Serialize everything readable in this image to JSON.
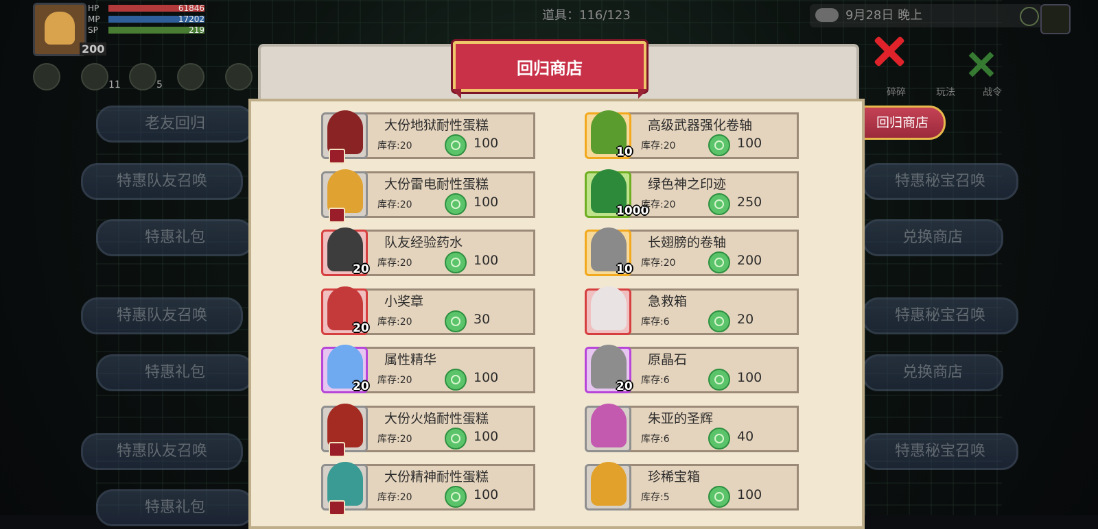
{
  "hud": {
    "stats": [
      {
        "label": "HP",
        "value": "61846",
        "color": "#d94a4a"
      },
      {
        "label": "MP",
        "value": "17202",
        "color": "#3f7fd1"
      },
      {
        "label": "SP",
        "value": "219",
        "color": "#6fb24b"
      }
    ],
    "level": "200",
    "icon_counts": [
      "",
      "11",
      "5",
      "",
      ""
    ]
  },
  "top_bar": {
    "items_count": "道具：116/123",
    "date": "9月28日  晚上"
  },
  "side_left": [
    "老友回归",
    "特惠队友召唤",
    "特惠礼包",
    "特惠队友召唤",
    "特惠礼包",
    "特惠队友召唤",
    "特惠礼包"
  ],
  "side_right": {
    "active_tab": "回归商店",
    "tabs": [
      "特惠秘宝召唤",
      "兑换商店",
      "特惠秘宝召唤",
      "兑换商店",
      "特惠秘宝召唤"
    ],
    "top_icons": [
      "碎碎",
      "玩法",
      "战令"
    ]
  },
  "modal": {
    "title": "回归商店",
    "items_left": [
      {
        "name": "大份地狱耐性蛋糕",
        "stock": "库存:20",
        "price": "100",
        "count": "",
        "frame": "grey",
        "color": "#8a2424",
        "badge": true
      },
      {
        "name": "大份雷电耐性蛋糕",
        "stock": "库存:20",
        "price": "100",
        "count": "",
        "frame": "grey",
        "color": "#e0a331",
        "badge": true
      },
      {
        "name": "队友经验药水",
        "stock": "库存:20",
        "price": "100",
        "count": "20",
        "frame": "red",
        "color": "#3d3d3d",
        "badge": false
      },
      {
        "name": "小奖章",
        "stock": "库存:20",
        "price": "30",
        "count": "20",
        "frame": "red",
        "color": "#c43a3a",
        "badge": false
      },
      {
        "name": "属性精华",
        "stock": "库存:20",
        "price": "100",
        "count": "20",
        "frame": "purple",
        "color": "#6fa9f0",
        "badge": false
      },
      {
        "name": "大份火焰耐性蛋糕",
        "stock": "库存:20",
        "price": "100",
        "count": "",
        "frame": "grey",
        "color": "#a32b22",
        "badge": true
      },
      {
        "name": "大份精神耐性蛋糕",
        "stock": "库存:20",
        "price": "100",
        "count": "",
        "frame": "grey",
        "color": "#3a9a94",
        "badge": true
      }
    ],
    "items_right": [
      {
        "name": "高级武器强化卷轴",
        "stock": "库存:20",
        "price": "100",
        "count": "10",
        "frame": "gold",
        "color": "#5b9c2f",
        "badge": false
      },
      {
        "name": "绿色神之印迹",
        "stock": "库存:20",
        "price": "250",
        "count": "1000",
        "frame": "green",
        "color": "#2e8a3b",
        "badge": false
      },
      {
        "name": "长翅膀的卷轴",
        "stock": "库存:20",
        "price": "200",
        "count": "10",
        "frame": "gold",
        "color": "#8a8a8a",
        "badge": false
      },
      {
        "name": "急救箱",
        "stock": "库存:6",
        "price": "20",
        "count": "",
        "frame": "red",
        "color": "#e9e3e3",
        "badge": false
      },
      {
        "name": "原晶石",
        "stock": "库存:6",
        "price": "100",
        "count": "20",
        "frame": "purple",
        "color": "#8d8d8d",
        "badge": false
      },
      {
        "name": "朱亚的圣辉",
        "stock": "库存:6",
        "price": "40",
        "count": "",
        "frame": "grey",
        "color": "#c45ab0",
        "badge": false
      },
      {
        "name": "珍稀宝箱",
        "stock": "库存:5",
        "price": "100",
        "count": "",
        "frame": "grey",
        "color": "#e2a12a",
        "badge": false
      }
    ]
  }
}
